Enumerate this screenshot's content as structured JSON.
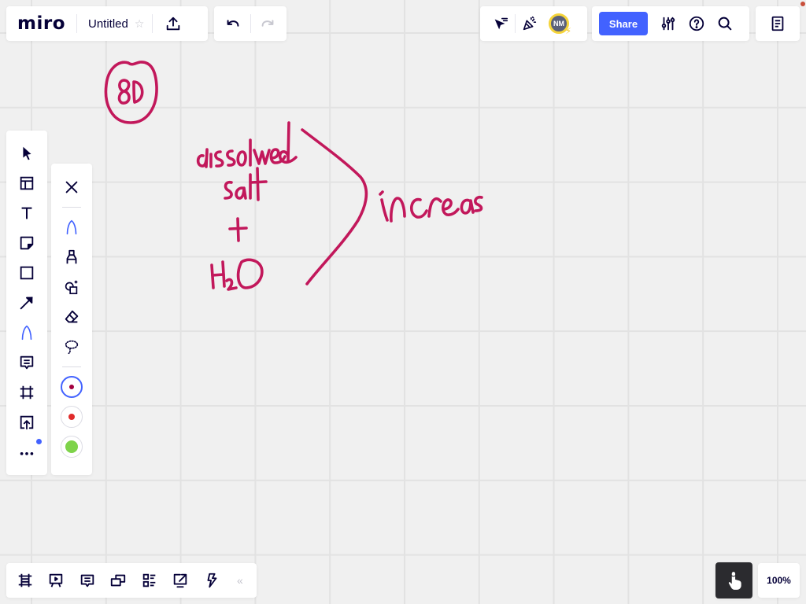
{
  "app": {
    "logo": "miro",
    "board_title": "Untitled",
    "zoom_level": "100%",
    "accent_color": "#4262ff",
    "ink_color": "#c2185b"
  },
  "top_left": {
    "star_icon": "star-icon",
    "upload_icon": "upload-icon",
    "undo_icon": "undo-icon",
    "redo_icon": "redo-icon"
  },
  "top_right": {
    "collab_icons": [
      "cursor-attention-icon",
      "celebrate-icon"
    ],
    "avatar_initials": "NM",
    "share_label": "Share",
    "action_icons": [
      "settings-sliders-icon",
      "help-icon",
      "search-icon"
    ],
    "notes_icon": "notes-icon"
  },
  "left_toolbar": {
    "tools": [
      {
        "name": "select",
        "icon": "cursor-icon"
      },
      {
        "name": "templates",
        "icon": "templates-icon"
      },
      {
        "name": "text",
        "icon": "text-icon"
      },
      {
        "name": "sticky-note",
        "icon": "sticky-note-icon"
      },
      {
        "name": "shape",
        "icon": "square-icon"
      },
      {
        "name": "connection-line",
        "icon": "arrow-icon"
      },
      {
        "name": "pen",
        "icon": "pen-icon",
        "active": true
      },
      {
        "name": "comment",
        "icon": "comment-icon"
      },
      {
        "name": "frame",
        "icon": "frame-icon"
      },
      {
        "name": "upload",
        "icon": "upload-icon"
      },
      {
        "name": "more",
        "icon": "more-icon"
      }
    ]
  },
  "pen_toolbar": {
    "tools": [
      {
        "name": "close",
        "icon": "close-icon"
      },
      {
        "name": "pen",
        "icon": "pen-icon",
        "active": true
      },
      {
        "name": "highlighter",
        "icon": "highlighter-icon"
      },
      {
        "name": "smart-drawing",
        "icon": "smart-shape-icon"
      },
      {
        "name": "eraser",
        "icon": "eraser-icon"
      },
      {
        "name": "lasso",
        "icon": "lasso-icon"
      }
    ],
    "colors": [
      {
        "name": "crimson",
        "hex": "#a3003f",
        "selected": true
      },
      {
        "name": "red",
        "hex": "#e02b2b",
        "selected": false
      },
      {
        "name": "green",
        "hex": "#7ed34a",
        "selected": false
      }
    ]
  },
  "bottom_toolbar": {
    "tools": [
      {
        "name": "frames",
        "icon": "frames-icon"
      },
      {
        "name": "presentation",
        "icon": "presentation-icon"
      },
      {
        "name": "comments",
        "icon": "comments-icon"
      },
      {
        "name": "video-chat",
        "icon": "video-chat-icon"
      },
      {
        "name": "cards",
        "icon": "cards-icon"
      },
      {
        "name": "screen-share",
        "icon": "screen-share-icon"
      },
      {
        "name": "activity",
        "icon": "lightning-icon"
      }
    ],
    "collapse_label": "«"
  },
  "canvas": {
    "handwriting": {
      "circled_number": "80",
      "left_lines": [
        "dissolved",
        "salt",
        "+",
        "H2O"
      ],
      "right_text": "increas"
    }
  }
}
